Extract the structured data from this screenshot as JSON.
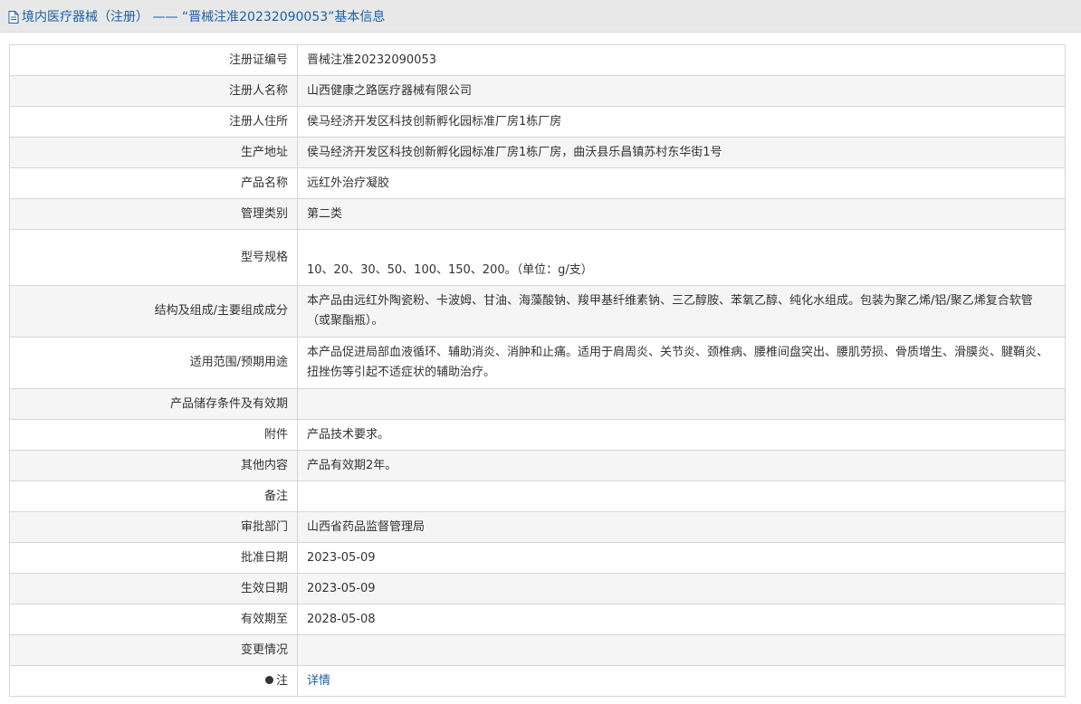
{
  "header": {
    "icon": "document-icon",
    "title": "境内医疗器械（注册）  ——  “晋械注准20232090053”基本信息"
  },
  "rows": [
    {
      "label": "注册证编号",
      "value": "晋械注准20232090053"
    },
    {
      "label": "注册人名称",
      "value": "山西健康之路医疗器械有限公司"
    },
    {
      "label": "注册人住所",
      "value": "侯马经济开发区科技创新孵化园标准厂房1栋厂房"
    },
    {
      "label": "生产地址",
      "value": "侯马经济开发区科技创新孵化园标准厂房1栋厂房，曲沃县乐昌镇苏村东华街1号"
    },
    {
      "label": "产品名称",
      "value": "远红外治疗凝胶"
    },
    {
      "label": "管理类别",
      "value": "第二类"
    },
    {
      "label": "型号规格",
      "value": "10、20、30、50、100、150、200。（单位：g/支）"
    },
    {
      "label": "结构及组成/主要组成成分",
      "value": "本产品由远红外陶瓷粉、卡波姆、甘油、海藻酸钠、羧甲基纤维素钠、三乙醇胺、苯氧乙醇、纯化水组成。包装为聚乙烯/铝/聚乙烯复合软管（或聚酯瓶）。"
    },
    {
      "label": "适用范围/预期用途",
      "value": "本产品促进局部血液循环、辅助消炎、消肿和止痛。适用于肩周炎、关节炎、颈椎病、腰椎间盘突出、腰肌劳损、骨质增生、滑膜炎、腱鞘炎、扭挫伤等引起不适症状的辅助治疗。"
    },
    {
      "label": "产品储存条件及有效期",
      "value": ""
    },
    {
      "label": "附件",
      "value": "产品技术要求。"
    },
    {
      "label": "其他内容",
      "value": "产品有效期2年。"
    },
    {
      "label": "备注",
      "value": ""
    },
    {
      "label": "审批部门",
      "value": "山西省药品监督管理局"
    },
    {
      "label": "批准日期",
      "value": "2023-05-09"
    },
    {
      "label": "生效日期",
      "value": "2023-05-09"
    },
    {
      "label": "有效期至",
      "value": "2028-05-08"
    },
    {
      "label": "变更情况",
      "value": ""
    }
  ],
  "note": {
    "icon": "info-dot-icon",
    "label": "注",
    "link_text": "详情"
  },
  "colors": {
    "accent": "#1c5fa8",
    "header_bg": "#e8e8e8",
    "row_alt": "#f5f5f5",
    "border": "#d6d6d6"
  }
}
